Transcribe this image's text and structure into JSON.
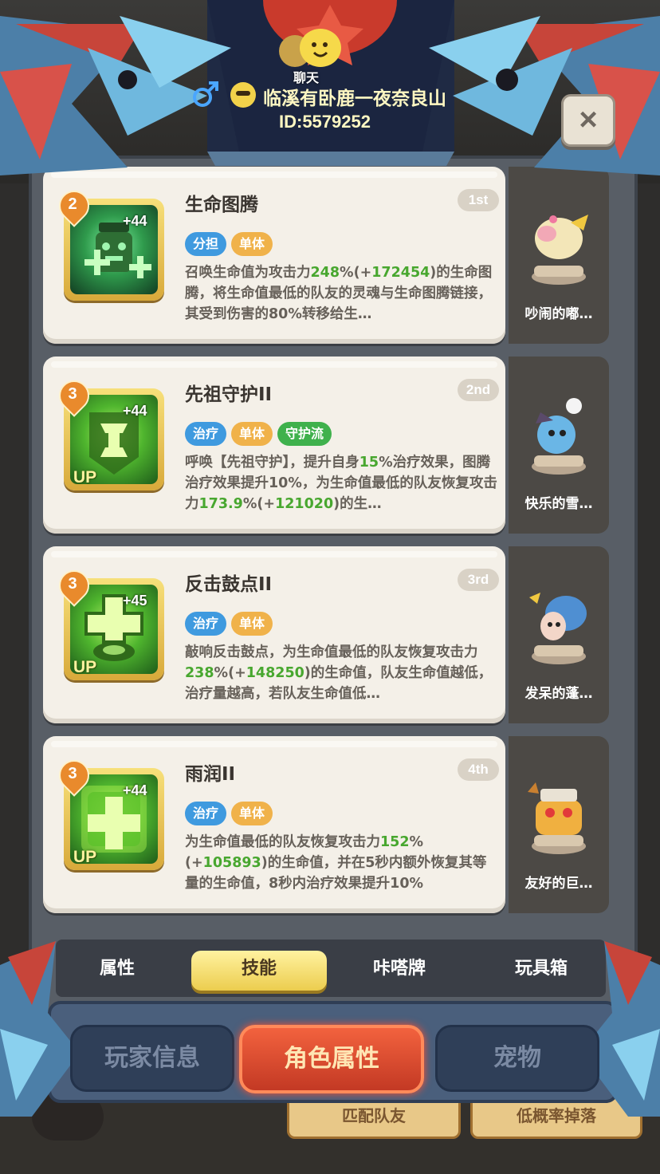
{
  "header": {
    "chat_label": "聊天",
    "username": "临溪有卧鹿一夜奈良山",
    "user_id": "ID:5579252",
    "close_symbol": "×"
  },
  "skills": [
    {
      "title": "生命图腾",
      "rank": "1st",
      "level": "2",
      "plus": "+44",
      "upgrade": "",
      "tags": [
        "分担",
        "单体"
      ],
      "desc_line1_a": "召唤生命值为攻击力",
      "desc_line1_g": "248",
      "desc_line1_b": "%(+",
      "desc_line1_g2": "172454",
      "desc_line1_c": ")的生",
      "desc_rest": "命图腾，将生命值最低的队友的灵魂与生命图腾链接，其受到伤害的80%转移给生…",
      "pet_name": "吵闹的嘟…"
    },
    {
      "title": "先祖守护II",
      "rank": "2nd",
      "level": "3",
      "plus": "+44",
      "upgrade": "UP",
      "tags": [
        "治疗",
        "单体",
        "守护流"
      ],
      "desc_a": "呼唤【先祖守护】，提升自身",
      "desc_g": "15",
      "desc_b": "%治疗效果，图腾治疗效果提升10%，为生命值最低的队友恢复攻击力",
      "desc_g2": "173.9",
      "desc_c": "%(+",
      "desc_g3": "121020",
      "desc_d": ")的生…",
      "pet_name": "快乐的雪…"
    },
    {
      "title": "反击鼓点II",
      "rank": "3rd",
      "level": "3",
      "plus": "+45",
      "upgrade": "UP",
      "tags": [
        "治疗",
        "单体"
      ],
      "desc_a": "敲响反击鼓点，为生命值最低的队友恢复攻击力",
      "desc_g": "238",
      "desc_b": "%(+",
      "desc_g2": "148250",
      "desc_c": ")的生命值，队友生命值越低，治疗量越高，若队友生命值低…",
      "pet_name": "发呆的蓬…"
    },
    {
      "title": "雨润II",
      "rank": "4th",
      "level": "3",
      "plus": "+44",
      "upgrade": "UP",
      "tags": [
        "治疗",
        "单体"
      ],
      "desc_a": "为生命值最低的队友恢复攻击力",
      "desc_g": "152",
      "desc_b": "%(+",
      "desc_g2": "105893",
      "desc_c": ")的生命值，并在5秒内额外恢复其等量的生命值，8秒内治疗效果提升10%",
      "pet_name": "友好的巨…"
    }
  ],
  "tabs": [
    "属性",
    "技能",
    "咔嗒牌",
    "玩具箱"
  ],
  "active_tab": "技能",
  "bottom_tabs": [
    "玩家信息",
    "角色属性",
    "宠物"
  ],
  "active_bottom_tab": "角色属性",
  "background_buttons": [
    "匹配队友",
    "低概率掉落"
  ],
  "colors": {
    "highlight_green": "#48a72f",
    "tag_blue": "#3f9adf",
    "tag_orange": "#f0b24a",
    "tag_green": "#3fb14c",
    "active_tab": "#eccd4e",
    "active_bottom_tab": "#d9472d"
  },
  "icons": [
    "chat-bubble-icon",
    "male-gender-icon",
    "user-avatar-icon",
    "close-icon",
    "totem-skill-icon",
    "ancestor-guard-skill-icon",
    "drum-skill-icon",
    "rain-heal-skill-icon"
  ]
}
